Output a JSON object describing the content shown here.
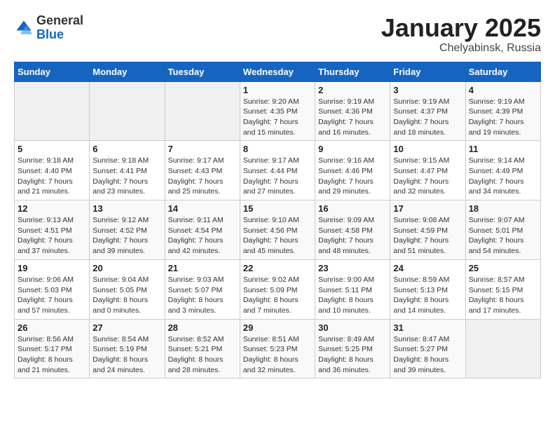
{
  "logo": {
    "general": "General",
    "blue": "Blue"
  },
  "header": {
    "month": "January 2025",
    "location": "Chelyabinsk, Russia"
  },
  "weekdays": [
    "Sunday",
    "Monday",
    "Tuesday",
    "Wednesday",
    "Thursday",
    "Friday",
    "Saturday"
  ],
  "weeks": [
    [
      {
        "day": "",
        "sunrise": "",
        "sunset": "",
        "daylight": ""
      },
      {
        "day": "",
        "sunrise": "",
        "sunset": "",
        "daylight": ""
      },
      {
        "day": "",
        "sunrise": "",
        "sunset": "",
        "daylight": ""
      },
      {
        "day": "1",
        "sunrise": "Sunrise: 9:20 AM",
        "sunset": "Sunset: 4:35 PM",
        "daylight": "Daylight: 7 hours and 15 minutes."
      },
      {
        "day": "2",
        "sunrise": "Sunrise: 9:19 AM",
        "sunset": "Sunset: 4:36 PM",
        "daylight": "Daylight: 7 hours and 16 minutes."
      },
      {
        "day": "3",
        "sunrise": "Sunrise: 9:19 AM",
        "sunset": "Sunset: 4:37 PM",
        "daylight": "Daylight: 7 hours and 18 minutes."
      },
      {
        "day": "4",
        "sunrise": "Sunrise: 9:19 AM",
        "sunset": "Sunset: 4:39 PM",
        "daylight": "Daylight: 7 hours and 19 minutes."
      }
    ],
    [
      {
        "day": "5",
        "sunrise": "Sunrise: 9:18 AM",
        "sunset": "Sunset: 4:40 PM",
        "daylight": "Daylight: 7 hours and 21 minutes."
      },
      {
        "day": "6",
        "sunrise": "Sunrise: 9:18 AM",
        "sunset": "Sunset: 4:41 PM",
        "daylight": "Daylight: 7 hours and 23 minutes."
      },
      {
        "day": "7",
        "sunrise": "Sunrise: 9:17 AM",
        "sunset": "Sunset: 4:43 PM",
        "daylight": "Daylight: 7 hours and 25 minutes."
      },
      {
        "day": "8",
        "sunrise": "Sunrise: 9:17 AM",
        "sunset": "Sunset: 4:44 PM",
        "daylight": "Daylight: 7 hours and 27 minutes."
      },
      {
        "day": "9",
        "sunrise": "Sunrise: 9:16 AM",
        "sunset": "Sunset: 4:46 PM",
        "daylight": "Daylight: 7 hours and 29 minutes."
      },
      {
        "day": "10",
        "sunrise": "Sunrise: 9:15 AM",
        "sunset": "Sunset: 4:47 PM",
        "daylight": "Daylight: 7 hours and 32 minutes."
      },
      {
        "day": "11",
        "sunrise": "Sunrise: 9:14 AM",
        "sunset": "Sunset: 4:49 PM",
        "daylight": "Daylight: 7 hours and 34 minutes."
      }
    ],
    [
      {
        "day": "12",
        "sunrise": "Sunrise: 9:13 AM",
        "sunset": "Sunset: 4:51 PM",
        "daylight": "Daylight: 7 hours and 37 minutes."
      },
      {
        "day": "13",
        "sunrise": "Sunrise: 9:12 AM",
        "sunset": "Sunset: 4:52 PM",
        "daylight": "Daylight: 7 hours and 39 minutes."
      },
      {
        "day": "14",
        "sunrise": "Sunrise: 9:11 AM",
        "sunset": "Sunset: 4:54 PM",
        "daylight": "Daylight: 7 hours and 42 minutes."
      },
      {
        "day": "15",
        "sunrise": "Sunrise: 9:10 AM",
        "sunset": "Sunset: 4:56 PM",
        "daylight": "Daylight: 7 hours and 45 minutes."
      },
      {
        "day": "16",
        "sunrise": "Sunrise: 9:09 AM",
        "sunset": "Sunset: 4:58 PM",
        "daylight": "Daylight: 7 hours and 48 minutes."
      },
      {
        "day": "17",
        "sunrise": "Sunrise: 9:08 AM",
        "sunset": "Sunset: 4:59 PM",
        "daylight": "Daylight: 7 hours and 51 minutes."
      },
      {
        "day": "18",
        "sunrise": "Sunrise: 9:07 AM",
        "sunset": "Sunset: 5:01 PM",
        "daylight": "Daylight: 7 hours and 54 minutes."
      }
    ],
    [
      {
        "day": "19",
        "sunrise": "Sunrise: 9:06 AM",
        "sunset": "Sunset: 5:03 PM",
        "daylight": "Daylight: 7 hours and 57 minutes."
      },
      {
        "day": "20",
        "sunrise": "Sunrise: 9:04 AM",
        "sunset": "Sunset: 5:05 PM",
        "daylight": "Daylight: 8 hours and 0 minutes."
      },
      {
        "day": "21",
        "sunrise": "Sunrise: 9:03 AM",
        "sunset": "Sunset: 5:07 PM",
        "daylight": "Daylight: 8 hours and 3 minutes."
      },
      {
        "day": "22",
        "sunrise": "Sunrise: 9:02 AM",
        "sunset": "Sunset: 5:09 PM",
        "daylight": "Daylight: 8 hours and 7 minutes."
      },
      {
        "day": "23",
        "sunrise": "Sunrise: 9:00 AM",
        "sunset": "Sunset: 5:11 PM",
        "daylight": "Daylight: 8 hours and 10 minutes."
      },
      {
        "day": "24",
        "sunrise": "Sunrise: 8:59 AM",
        "sunset": "Sunset: 5:13 PM",
        "daylight": "Daylight: 8 hours and 14 minutes."
      },
      {
        "day": "25",
        "sunrise": "Sunrise: 8:57 AM",
        "sunset": "Sunset: 5:15 PM",
        "daylight": "Daylight: 8 hours and 17 minutes."
      }
    ],
    [
      {
        "day": "26",
        "sunrise": "Sunrise: 8:56 AM",
        "sunset": "Sunset: 5:17 PM",
        "daylight": "Daylight: 8 hours and 21 minutes."
      },
      {
        "day": "27",
        "sunrise": "Sunrise: 8:54 AM",
        "sunset": "Sunset: 5:19 PM",
        "daylight": "Daylight: 8 hours and 24 minutes."
      },
      {
        "day": "28",
        "sunrise": "Sunrise: 8:52 AM",
        "sunset": "Sunset: 5:21 PM",
        "daylight": "Daylight: 8 hours and 28 minutes."
      },
      {
        "day": "29",
        "sunrise": "Sunrise: 8:51 AM",
        "sunset": "Sunset: 5:23 PM",
        "daylight": "Daylight: 8 hours and 32 minutes."
      },
      {
        "day": "30",
        "sunrise": "Sunrise: 8:49 AM",
        "sunset": "Sunset: 5:25 PM",
        "daylight": "Daylight: 8 hours and 36 minutes."
      },
      {
        "day": "31",
        "sunrise": "Sunrise: 8:47 AM",
        "sunset": "Sunset: 5:27 PM",
        "daylight": "Daylight: 8 hours and 39 minutes."
      },
      {
        "day": "",
        "sunrise": "",
        "sunset": "",
        "daylight": ""
      }
    ]
  ]
}
